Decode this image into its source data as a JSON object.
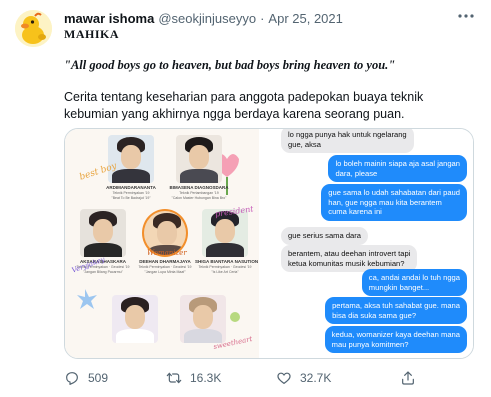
{
  "tweet": {
    "author_name": "mawar ishoma",
    "author_handle": "@seokjinjuseyyo",
    "separator": "·",
    "date": "Apr 25, 2021",
    "title": "MAHIKA",
    "quote": "\"All good boys go to heaven, but bad boys bring heaven to you.\"",
    "description": "Cerita tentang keseharian para anggota padepokan buaya teknik kebumian yang akhirnya ngga berdaya karena seorang puan."
  },
  "media": {
    "cards": [
      {
        "name": "ARDIMANDARANANTA",
        "line1": "Teknik Perminyakan '19",
        "line2": "\"Beat To Be Badrajut '19\""
      },
      {
        "name": "BIMASENA DIAGNOSDARA",
        "line1": "Teknik Pertambangan '19",
        "line2": "\"Calon Master Hubungan Bina Bro\""
      },
      {
        "name": "AKSARA BHASKARA",
        "line1": "Teknik Perminyakan · Geodesi '19",
        "line2": "\"Jangan Bilang Pacarmu\""
      },
      {
        "name": "DEEHAN DHARMAJAYA",
        "line1": "Teknik Perminyakan · Geodesi '19",
        "line2": "\"Jangan Lupa Minta Maaf\""
      },
      {
        "name": "SHIGA BIANTARA NASUTION",
        "line1": "Teknik Perminyakan · Geodesi '19",
        "line2": "\"Is Like Art Ceria\""
      },
      {
        "name": "",
        "line1": "",
        "line2": ""
      },
      {
        "name": "",
        "line1": "",
        "line2": ""
      }
    ],
    "stickers": {
      "best_boy": "best boy",
      "president": "president",
      "womanizer": "Womanizer",
      "heart": "sweetheart",
      "good": "Veryjakey"
    },
    "chat": [
      {
        "dir": "in",
        "text": "lo ngga punya hak untuk ngelarang\ngue, aksa"
      },
      {
        "dir": "out",
        "text": "lo boleh mainin siapa aja asal jangan\ndara, please"
      },
      {
        "dir": "out",
        "text": "gue sama lo udah sahabatan dari paud\nhan, gue ngga mau kita berantem\ncuma karena ini"
      },
      {
        "dir": "in",
        "text": "gue serius sama dara"
      },
      {
        "dir": "in",
        "text": "berantem, atau deehan introvert tapi\nketua komunitas musik kebumian?"
      },
      {
        "dir": "out",
        "text": "ca, andai andai lo tuh ngga\nmungkin banget..."
      },
      {
        "dir": "out",
        "text": "pertama, aksa tuh sahabat gue. mana\nbisa dia suka sama gue?"
      },
      {
        "dir": "out",
        "text": "kedua, womanizer kaya deehan mana\nmau punya komitmen?"
      }
    ]
  },
  "stats": {
    "replies": "509",
    "retweets": "16.3K",
    "likes": "32.7K"
  },
  "icons": {
    "avatar": "yellow-duck-avatar",
    "more": "more-dots-icon",
    "reply": "reply-icon",
    "retweet": "retweet-icon",
    "like": "heart-icon",
    "share": "share-icon"
  },
  "colors": {
    "text": "#0f1419",
    "muted": "#536471",
    "bubble_out": "#1f8bfb",
    "bubble_in": "#e9e9eb"
  }
}
